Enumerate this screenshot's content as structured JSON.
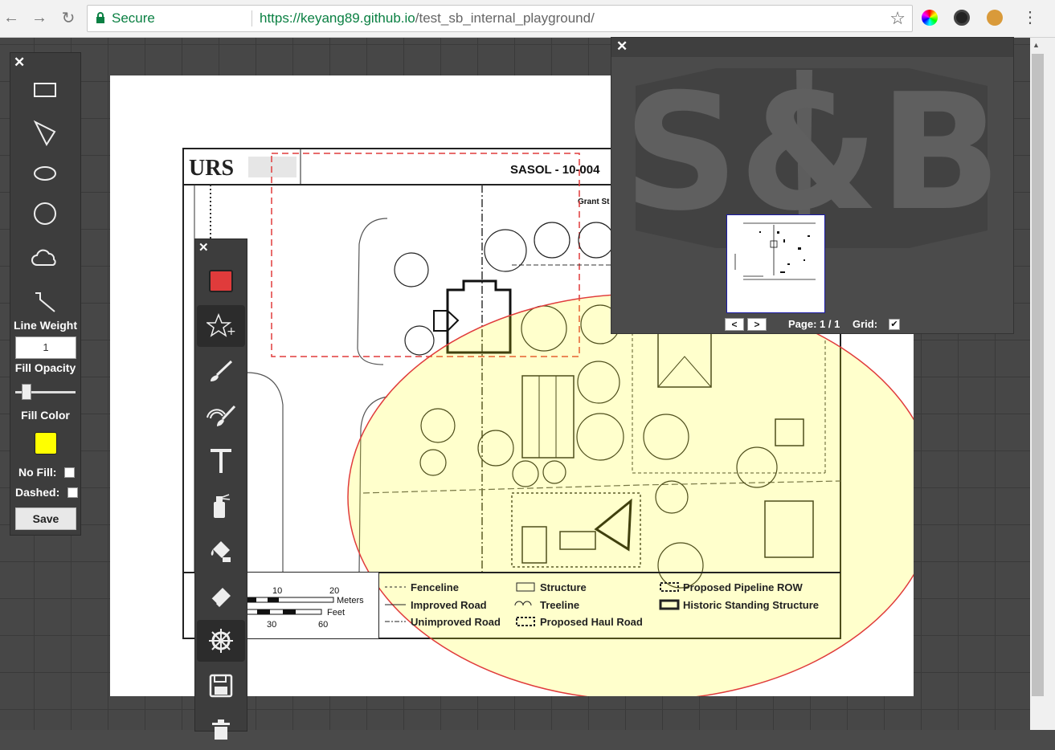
{
  "browser": {
    "secure_label": "Secure",
    "url_host": "https://keyang89.github.io",
    "url_path": "/test_sb_internal_playground/"
  },
  "left_panel": {
    "shapes": [
      "rectangle-icon",
      "triangle-icon",
      "ellipse-icon",
      "circle-icon",
      "cloud-icon",
      "polyline-icon"
    ],
    "line_weight_label": "Line Weight",
    "line_weight_value": "1",
    "fill_opacity_label": "Fill Opacity",
    "fill_opacity_value": 0.2,
    "fill_color_label": "Fill Color",
    "fill_color": "#ffff00",
    "no_fill_label": "No Fill:",
    "dashed_label": "Dashed:",
    "save_label": "Save"
  },
  "mid_toolbar": {
    "stroke_color": "#e03b3b",
    "tools": [
      "stroke-color-swatch",
      "stamp-add-icon",
      "brush-icon",
      "rainbow-brush-icon",
      "text-tool-icon",
      "spray-icon",
      "paint-bucket-icon",
      "eraser-icon",
      "ship-wheel-icon",
      "save-disk-icon",
      "trash-icon"
    ]
  },
  "overview": {
    "prev_label": "<",
    "next_label": ">",
    "page_text": "Page: 1 / 1",
    "grid_label": "Grid:",
    "grid_checked": "✔",
    "logo_text": "S&B"
  },
  "document": {
    "urs_logo": "URS",
    "title": "SASOL - 10-004",
    "street": "Grant St",
    "scale_meters_0": "10",
    "scale_meters_1": "20",
    "meters_label": "Meters",
    "feet_label": "Feet",
    "scale_feet_0": "30",
    "scale_feet_1": "60",
    "legend": {
      "fenceline": "Fenceline",
      "improved_road": "Improved Road",
      "unimproved_road": "Unimproved Road",
      "structure": "Structure",
      "treeline": "Treeline",
      "haul_road": "Proposed Haul Road",
      "pipeline_row": "Proposed Pipeline ROW",
      "historic": "Historic Standing Structure"
    }
  },
  "colors": {
    "annotation_red": "#e03b3b",
    "ellipse_fill": "#ffff00"
  }
}
